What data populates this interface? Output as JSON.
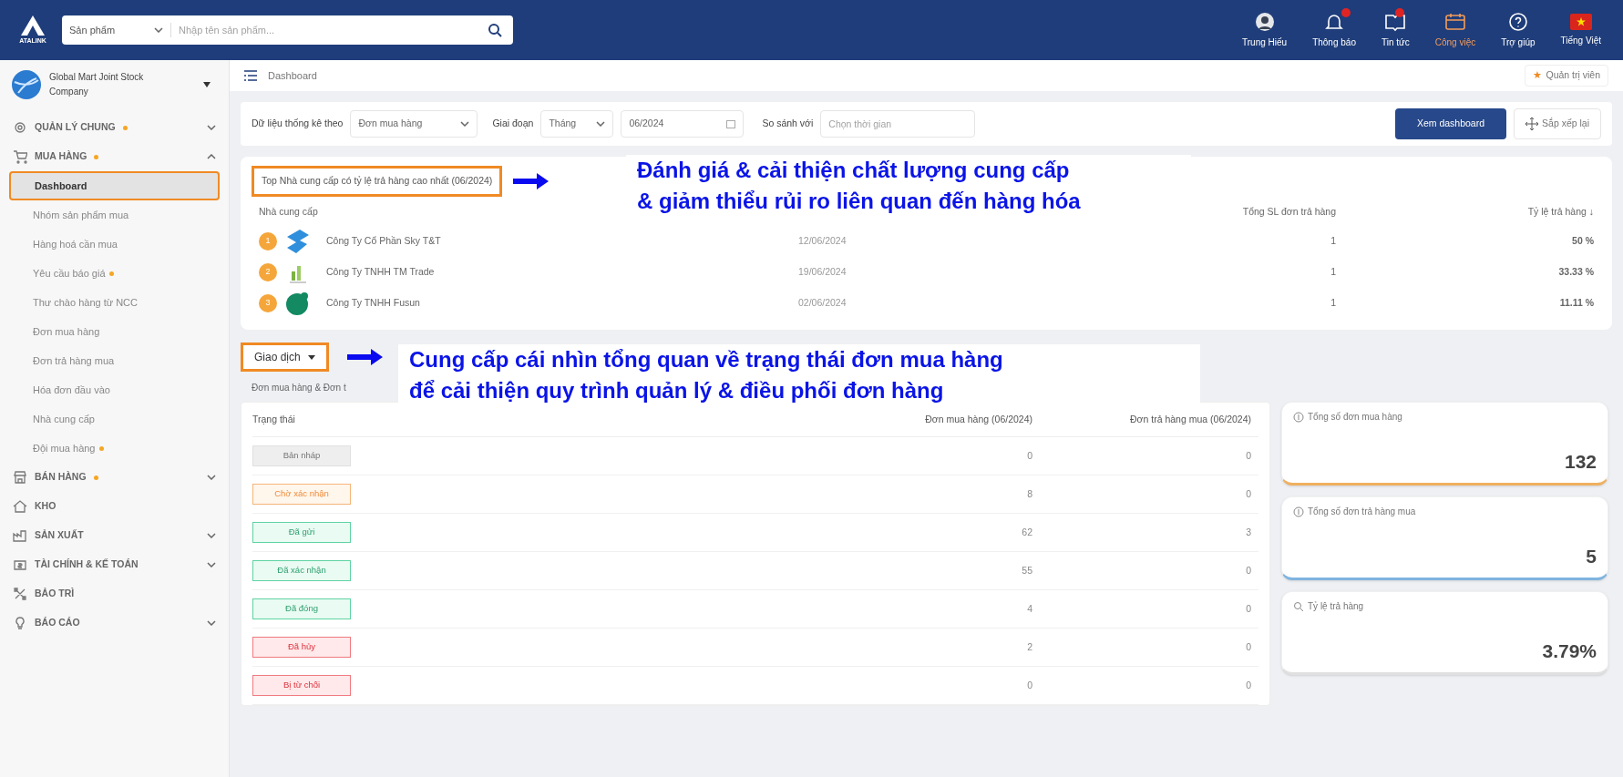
{
  "topbar": {
    "logo_text": "ATALINK",
    "search_category": "Sản phẩm",
    "search_placeholder": "Nhập tên sản phẩm...",
    "nav": [
      {
        "kind": "avatar",
        "label": "Trung Hiếu",
        "badge": false,
        "selected": false
      },
      {
        "kind": "bell",
        "label": "Thông báo",
        "badge": true,
        "selected": false
      },
      {
        "kind": "news",
        "label": "Tin tức",
        "badge": true,
        "selected": false
      },
      {
        "kind": "calendar",
        "label": "Công việc",
        "badge": false,
        "selected": true
      },
      {
        "kind": "help",
        "label": "Trợ giúp",
        "badge": false,
        "selected": false
      },
      {
        "kind": "flag",
        "label": "Tiếng Việt",
        "badge": false,
        "selected": false
      }
    ]
  },
  "sidebar": {
    "company": "Global Mart Joint Stock Company",
    "items": [
      {
        "label": "QUẢN LÝ CHUNG",
        "dot": true,
        "expandable": true,
        "expanded": false
      },
      {
        "label": "MUA HÀNG",
        "dot": true,
        "expandable": true,
        "expanded": true,
        "children": [
          {
            "label": "Dashboard",
            "selected": true,
            "dot": false
          },
          {
            "label": "Nhóm sản phẩm mua",
            "selected": false,
            "dot": false
          },
          {
            "label": "Hàng hoá cần mua",
            "selected": false,
            "dot": false
          },
          {
            "label": "Yêu cầu báo giá",
            "selected": false,
            "dot": true
          },
          {
            "label": "Thư chào hàng từ NCC",
            "selected": false,
            "dot": false
          },
          {
            "label": "Đơn mua hàng",
            "selected": false,
            "dot": false
          },
          {
            "label": "Đơn trả hàng mua",
            "selected": false,
            "dot": false
          },
          {
            "label": "Hóa đơn đầu vào",
            "selected": false,
            "dot": false
          },
          {
            "label": "Nhà cung cấp",
            "selected": false,
            "dot": false
          },
          {
            "label": "Đội mua hàng",
            "selected": false,
            "dot": true
          }
        ]
      },
      {
        "label": "BÁN HÀNG",
        "dot": true,
        "expandable": true,
        "expanded": false
      },
      {
        "label": "KHO",
        "dot": false,
        "expandable": false
      },
      {
        "label": "SẢN XUẤT",
        "dot": false,
        "expandable": true,
        "expanded": false
      },
      {
        "label": "TÀI CHÍNH & KẾ TOÁN",
        "dot": false,
        "expandable": true,
        "expanded": false
      },
      {
        "label": "BẢO TRÌ",
        "dot": false,
        "expandable": false
      },
      {
        "label": "BÁO CÁO",
        "dot": false,
        "expandable": true,
        "expanded": false
      }
    ]
  },
  "breadcrumb": "Dashboard",
  "role": "Quản trị viên",
  "role_star": "★",
  "filters": {
    "stat_label": "Dữ liệu thống kê theo",
    "stat_value": "Đơn mua hàng",
    "period_label": "Giai đoạn",
    "period_value": "Tháng",
    "date_value": "06/2024",
    "compare_label": "So sánh với",
    "compare_placeholder": "Chọn thời gian",
    "view_button": "Xem dashboard",
    "arrange_button": "Sắp xếp lại"
  },
  "suppliers": {
    "title": "Top Nhà cung cấp có tỷ lệ trả hàng cao nhất (06/2024)",
    "columns": [
      "Nhà cung cấp",
      "Tổng SL đơn trả hàng",
      "Tỷ lệ trả hàng ↓"
    ],
    "rows": [
      {
        "rank": "1",
        "name": "Công Ty Cổ Phần Sky T&T",
        "date": "12/06/2024",
        "count": "1",
        "rate": "50 %"
      },
      {
        "rank": "2",
        "name": "Công Ty TNHH TM Trade",
        "date": "19/06/2024",
        "count": "1",
        "rate": "33.33 %"
      },
      {
        "rank": "3",
        "name": "Công Ty TNHH Fusun",
        "date": "02/06/2024",
        "count": "1",
        "rate": "11.11 %"
      }
    ]
  },
  "transactions": {
    "dropdown": "Giao dịch",
    "subtitle": "Đơn mua hàng & Đơn t",
    "columns": [
      "Trạng thái",
      "Đơn mua hàng (06/2024)",
      "Đơn trả hàng mua (06/2024)"
    ],
    "rows": [
      {
        "status": "Bản nháp",
        "kind": "draft",
        "orders": "0",
        "returns": "0"
      },
      {
        "status": "Chờ xác nhận",
        "kind": "pending",
        "orders": "8",
        "returns": "0"
      },
      {
        "status": "Đã gửi",
        "kind": "success",
        "orders": "62",
        "returns": "3"
      },
      {
        "status": "Đã xác nhận",
        "kind": "success",
        "orders": "55",
        "returns": "0"
      },
      {
        "status": "Đã đóng",
        "kind": "success",
        "orders": "4",
        "returns": "0"
      },
      {
        "status": "Đã hủy",
        "kind": "danger",
        "orders": "2",
        "returns": "0"
      },
      {
        "status": "Bị từ chối",
        "kind": "danger",
        "orders": "0",
        "returns": "0"
      }
    ],
    "stats": [
      {
        "label": "Tổng số đơn mua hàng",
        "value": "132",
        "color": "#f0b060"
      },
      {
        "label": "Tổng số đơn trả hàng mua",
        "value": "5",
        "color": "#7fb4e0"
      },
      {
        "label": "Tỷ lệ trả hàng",
        "value": "3.79%",
        "color": "#e0e0e0"
      }
    ]
  },
  "annotations": [
    {
      "text": "Đánh giá & cải thiện chất lượng cung cấp\n& giảm thiểu rủi ro liên quan đến hàng hóa"
    },
    {
      "text": "Cung cấp cái nhìn tổng quan về trạng thái đơn mua hàng\nđể cải thiện quy trình quản lý & điều phối đơn hàng"
    }
  ]
}
